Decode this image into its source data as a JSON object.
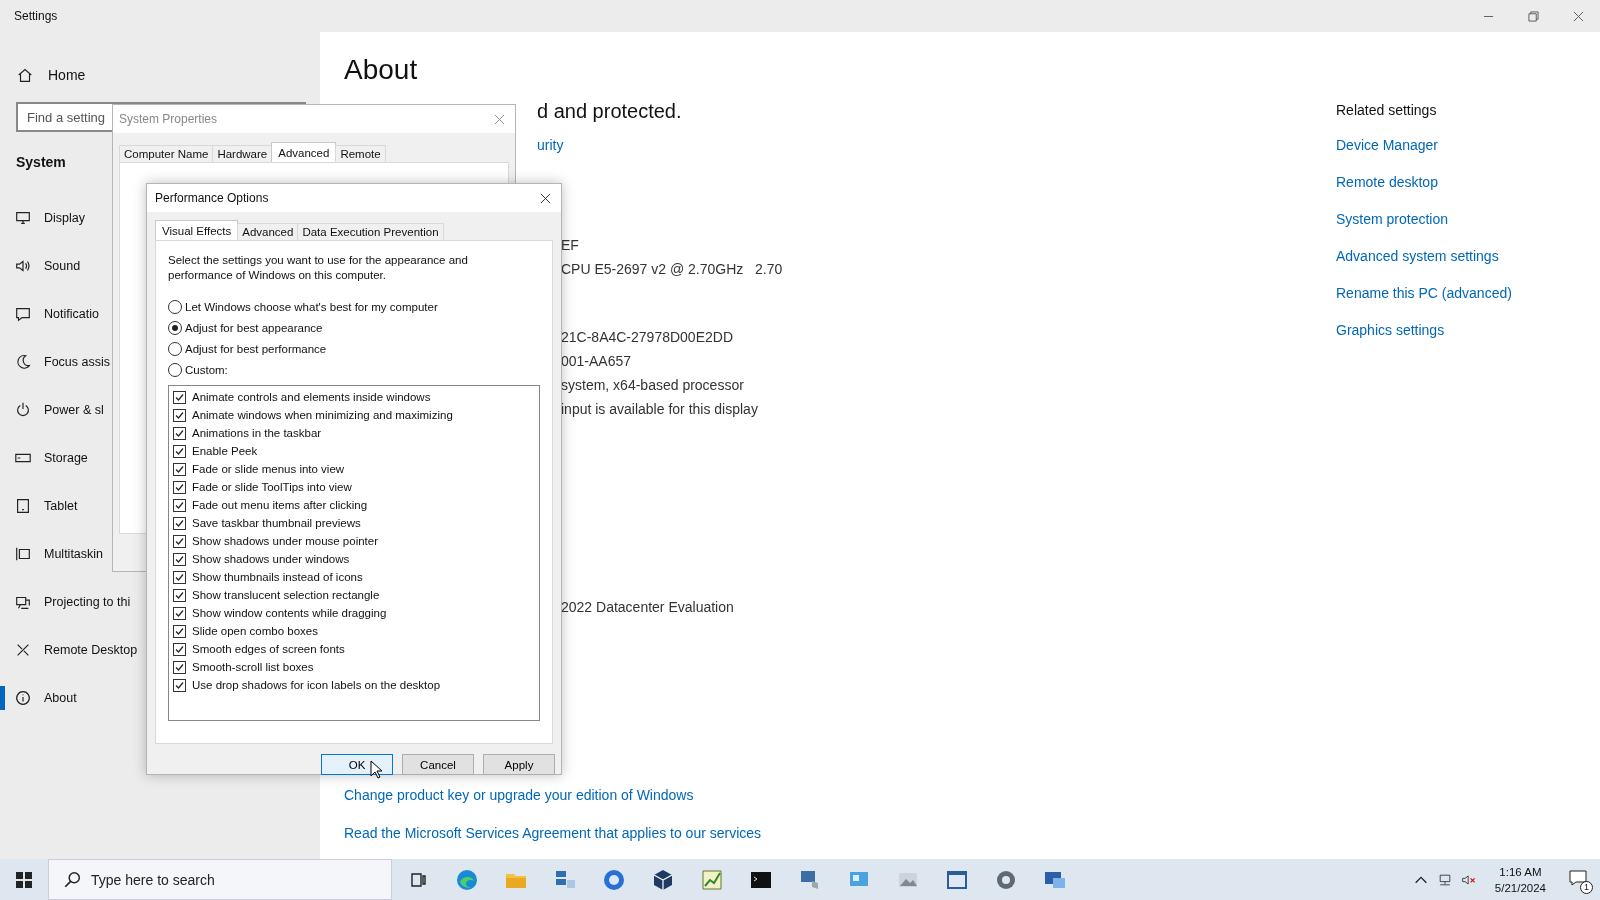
{
  "settings": {
    "title": "Settings",
    "home": "Home",
    "search": {
      "placeholder": "Find a setting"
    },
    "section": "System",
    "nav": [
      {
        "label": "Display",
        "selected": false
      },
      {
        "label": "Sound",
        "selected": false
      },
      {
        "label": "Notificatio",
        "selected": false
      },
      {
        "label": "Focus assis",
        "selected": false
      },
      {
        "label": "Power & sl",
        "selected": false
      },
      {
        "label": "Storage",
        "selected": false
      },
      {
        "label": "Tablet",
        "selected": false
      },
      {
        "label": "Multitaskin",
        "selected": false
      },
      {
        "label": "Projecting to thi",
        "selected": false
      },
      {
        "label": "Remote Desktop",
        "selected": false
      },
      {
        "label": "About",
        "selected": true
      }
    ],
    "heading": "About",
    "status": "d and protected.",
    "security_link": "urity",
    "specs": [
      [
        "EF",
        "CPU E5-2697 v2 @ 2.70GHz   2.70"
      ],
      [
        "21C-8A4C-27978D00E2DD",
        "001-AA657",
        "system, x64-based processor",
        "input is available for this display"
      ],
      [
        "2022 Datacenter Evaluation"
      ]
    ],
    "links": [
      "Change product key or upgrade your edition of Windows",
      "Read the Microsoft Services Agreement that applies to our services"
    ],
    "related": {
      "title": "Related settings",
      "links": [
        "Device Manager",
        "Remote desktop",
        "System protection",
        "Advanced system settings",
        "Rename this PC (advanced)",
        "Graphics settings"
      ]
    }
  },
  "system_properties": {
    "title": "System Properties",
    "tabs": [
      {
        "label": "Computer Name",
        "selected": false
      },
      {
        "label": "Hardware",
        "selected": false
      },
      {
        "label": "Advanced",
        "selected": true
      },
      {
        "label": "Remote",
        "selected": false
      }
    ]
  },
  "performance_options": {
    "title": "Performance Options",
    "tabs": [
      {
        "label": "Visual Effects",
        "selected": true
      },
      {
        "label": "Advanced",
        "selected": false
      },
      {
        "label": "Data Execution Prevention",
        "selected": false
      }
    ],
    "description": "Select the settings you want to use for the appearance and performance of Windows on this computer.",
    "options": [
      {
        "label": "Let Windows choose what's best for my computer",
        "selected": false
      },
      {
        "label": "Adjust for best appearance",
        "selected": true
      },
      {
        "label": "Adjust for best performance",
        "selected": false
      },
      {
        "label": "Custom:",
        "selected": false
      }
    ],
    "effects": [
      {
        "label": "Animate controls and elements inside windows",
        "checked": true
      },
      {
        "label": "Animate windows when minimizing and maximizing",
        "checked": true
      },
      {
        "label": "Animations in the taskbar",
        "checked": true
      },
      {
        "label": "Enable Peek",
        "checked": true
      },
      {
        "label": "Fade or slide menus into view",
        "checked": true
      },
      {
        "label": "Fade or slide ToolTips into view",
        "checked": true
      },
      {
        "label": "Fade out menu items after clicking",
        "checked": true
      },
      {
        "label": "Save taskbar thumbnail previews",
        "checked": true
      },
      {
        "label": "Show shadows under mouse pointer",
        "checked": true
      },
      {
        "label": "Show shadows under windows",
        "checked": true
      },
      {
        "label": "Show thumbnails instead of icons",
        "checked": true
      },
      {
        "label": "Show translucent selection rectangle",
        "checked": true
      },
      {
        "label": "Show window contents while dragging",
        "checked": true
      },
      {
        "label": "Slide open combo boxes",
        "checked": true
      },
      {
        "label": "Smooth edges of screen fonts",
        "checked": true
      },
      {
        "label": "Smooth-scroll list boxes",
        "checked": true
      },
      {
        "label": "Use drop shadows for icon labels on the desktop",
        "checked": true
      }
    ],
    "buttons": [
      {
        "label": "OK",
        "default": true
      },
      {
        "label": "Cancel",
        "default": false
      },
      {
        "label": "Apply",
        "default": false
      }
    ]
  },
  "taskbar": {
    "search": {
      "placeholder": "Type here to search"
    },
    "time": "1:16 AM",
    "date": "5/21/2024",
    "notifications": "1"
  }
}
